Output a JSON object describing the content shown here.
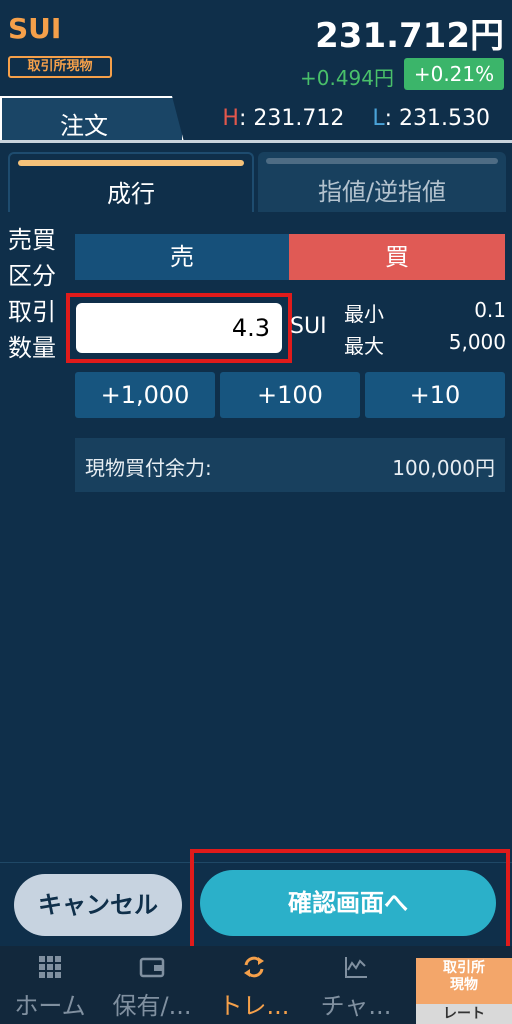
{
  "header": {
    "symbol": "SUI",
    "market_badge": "取引所現物",
    "price": "231.712円",
    "change": "+0.494円",
    "change_pct": "+0.21%"
  },
  "tabs": {
    "order_tab": "注文",
    "high_key": "H",
    "high_value": ": 231.712",
    "low_key": "L",
    "low_value": ": 231.530",
    "market": "成行",
    "limit": "指値/逆指値"
  },
  "form": {
    "side_label_1": "売買",
    "side_label_2": "区分",
    "sell": "売",
    "buy": "買",
    "qty_label_1": "取引",
    "qty_label_2": "数量",
    "qty_value": "4.3",
    "qty_unit": "SUI",
    "min_label": "最小",
    "min_value": "0.1",
    "max_label": "最大",
    "max_value": "5,000",
    "inc_1000": "+1,000",
    "inc_100": "+100",
    "inc_10": "+10",
    "funds_label": "現物買付余力:",
    "funds_value": "100,000円"
  },
  "actions": {
    "cancel": "キャンセル",
    "confirm": "確認画面へ"
  },
  "nav": {
    "home": "ホーム",
    "holdings": "保有/...",
    "trade": "トレ...",
    "chart": "チャ...",
    "rate_title_1": "取引所",
    "rate_title_2": "現物",
    "rate_sub": "レート"
  },
  "colors": {
    "background": "#0f2f4a",
    "accent_orange": "#f5a04a",
    "buy_red": "#e05a55",
    "sell_blue": "#16507a",
    "confirm_teal": "#2bb0c9",
    "up_green": "#3bb56a"
  }
}
